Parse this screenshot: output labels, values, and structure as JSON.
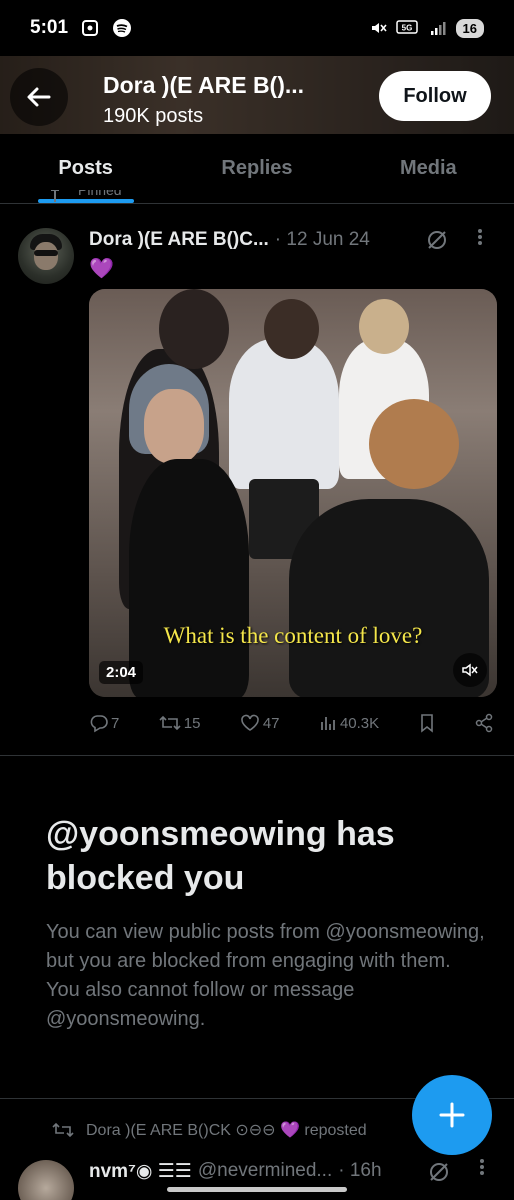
{
  "status_bar": {
    "time": "5:01",
    "network": "5G",
    "battery": "16"
  },
  "header": {
    "name": "Dora 🅱︎⃝E ARE B⃝⃝...",
    "name_display": "Dora )(E ARE B()...",
    "post_count": "190K posts",
    "follow_label": "Follow"
  },
  "tabs": [
    {
      "label": "Posts",
      "active": true
    },
    {
      "label": "Replies",
      "active": false
    },
    {
      "label": "Media",
      "active": false
    }
  ],
  "pinned_label": "Pinned",
  "tweet": {
    "name": "Dora )(E ARE B()C...",
    "date": "· 12 Jun 24",
    "text_emoji": "💜",
    "video": {
      "caption": "What is the content of love?",
      "duration": "2:04"
    },
    "stats": {
      "replies": "7",
      "reposts": "15",
      "likes": "47",
      "views": "40.3K"
    }
  },
  "blocked": {
    "title": "@yoonsmeowing has blocked you",
    "description": "You can view public posts from @yoonsmeowing, but you are blocked from engaging with them. You also cannot follow or message @yoonsmeowing."
  },
  "next_tweet": {
    "repost_text": "Dora )(E ARE B()CK ⊙⊖⊖ 💜 reposted",
    "name": "nvm⁷◉ ☰☰",
    "handle": "@nevermined...",
    "time": "· 16h"
  },
  "colors": {
    "accent": "#1d9bf0",
    "background": "#000000",
    "muted_text": "#71767b",
    "primary_text": "#e7e9ea",
    "caption_yellow": "#f4e64a"
  }
}
